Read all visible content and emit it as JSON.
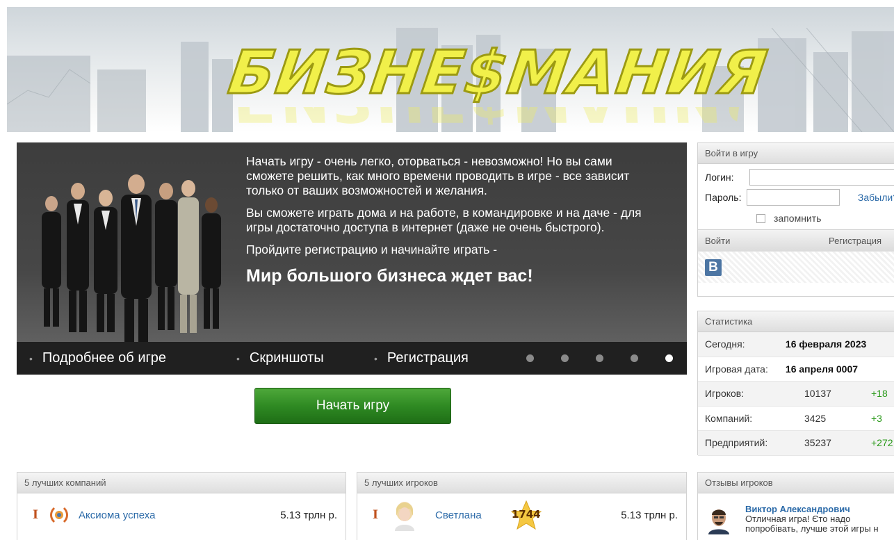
{
  "header": {
    "logo_text": "БИЗНЕ$МАНИЯ"
  },
  "promo": {
    "paragraphs": [
      "Начать игру - очень легко, оторваться - невозможно! Но вы сами сможете решить, как много времени проводить в игре - все зависит только от ваших возможностей и желания.",
      "Вы сможете играть дома и на работе, в командировке и на даче - для игры достаточно доступа в интернет (даже не очень быстрого).",
      "Пройдите регистрацию и начинайте играть -"
    ],
    "headline": "Мир большого бизнеса ждет вас!",
    "nav": [
      "Подробнее об игре",
      "Скриншоты",
      "Регистрация"
    ],
    "slides_count": 5,
    "active_slide": 5
  },
  "start_button": "Начать игру",
  "login": {
    "title": "Войти в игру",
    "login_label": "Логин:",
    "password_label": "Пароль:",
    "forgot": "Забыли?",
    "remember": "запомнить",
    "submit": "Войти",
    "register": "Регистрация",
    "vk": "B"
  },
  "stats": {
    "title": "Статистика",
    "today_label": "Сегодня:",
    "today_value": "16 февраля 2023",
    "game_date_label": "Игровая дата:",
    "game_date_value": "16 апреля 0007",
    "players_label": "Игроков:",
    "players_value": "10137",
    "players_delta": "+18",
    "companies_label": "Компаний:",
    "companies_value": "3425",
    "companies_delta": "+3",
    "enterprises_label": "Предприятий:",
    "enterprises_value": "35237",
    "enterprises_delta": "+272"
  },
  "top_companies": {
    "title": "5 лучших компаний",
    "rank": "I",
    "name": "Аксиома успеха",
    "value": "5.13 трлн р."
  },
  "top_players": {
    "title": "5 лучших игроков",
    "rank": "I",
    "name": "Светлана",
    "level": "1744",
    "value": "5.13 трлн р."
  },
  "reviews": {
    "title": "Отзывы игроков",
    "author": "Виктор Александрович",
    "text": "Отличная игра! Єто надо попробівать, лучше этой игры н"
  },
  "colors": {
    "accent_link": "#2b6aa8",
    "start_green": "#2f8a23",
    "delta_green": "#2a9a1a",
    "rank_orange": "#c0511d"
  }
}
